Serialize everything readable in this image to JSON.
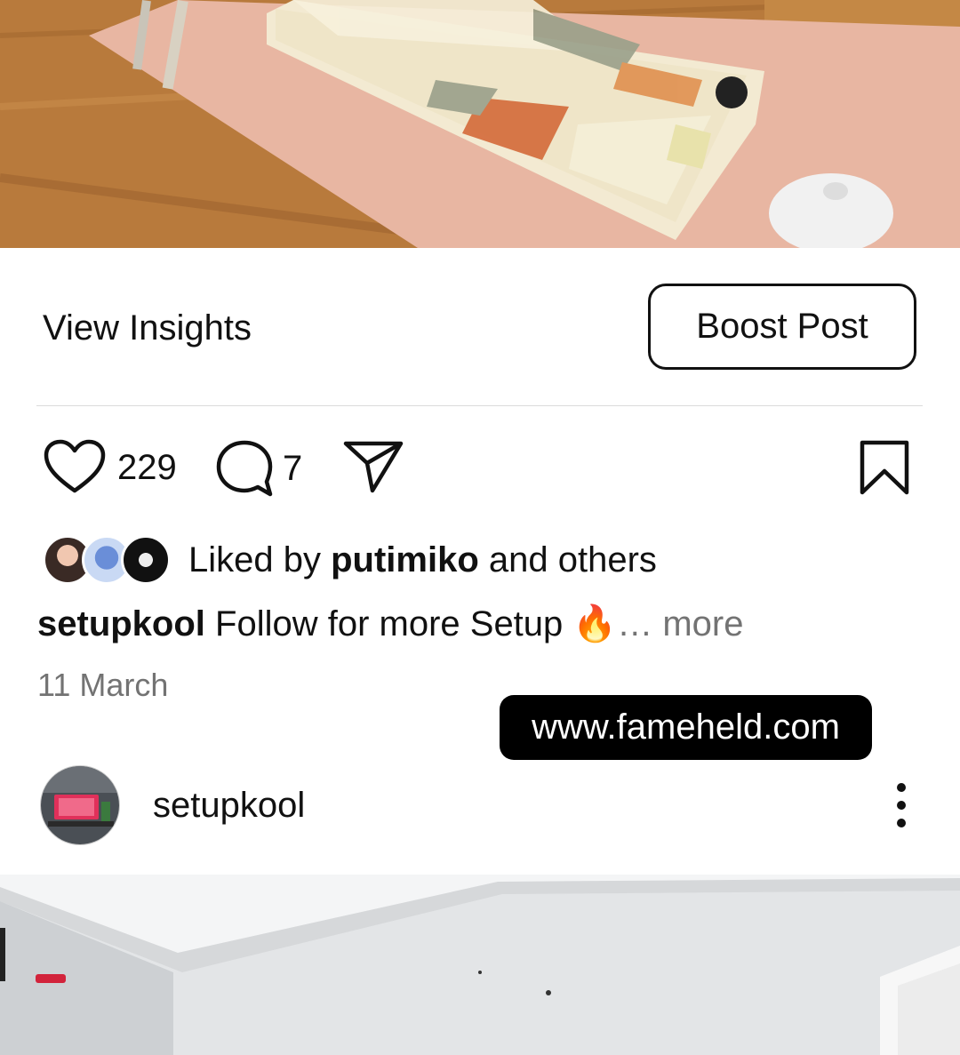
{
  "post": {
    "image_top_alt": "keyboard-setup-photo",
    "view_insights": "View Insights",
    "boost_post": "Boost Post",
    "likes_count": "229",
    "comments_count": "7",
    "liked_by_prefix": "Liked by ",
    "liked_by_user": "putimiko",
    "liked_by_suffix": " and others",
    "caption_user": "setupkool",
    "caption_text": " Follow for more Setup ",
    "caption_emoji": "🔥",
    "caption_more": "… more",
    "date": "11 March"
  },
  "watermark": {
    "text": "www.fameheld.com"
  },
  "next_post": {
    "username": "setupkool"
  },
  "icons": {
    "like": "heart-icon",
    "comment": "comment-bubble-icon",
    "share": "paper-plane-icon",
    "save": "bookmark-icon",
    "more": "more-vertical-icon"
  },
  "colors": {
    "text": "#111111",
    "muted": "#737373",
    "divider": "#dbdbdb",
    "watermark_bg": "#000000"
  }
}
